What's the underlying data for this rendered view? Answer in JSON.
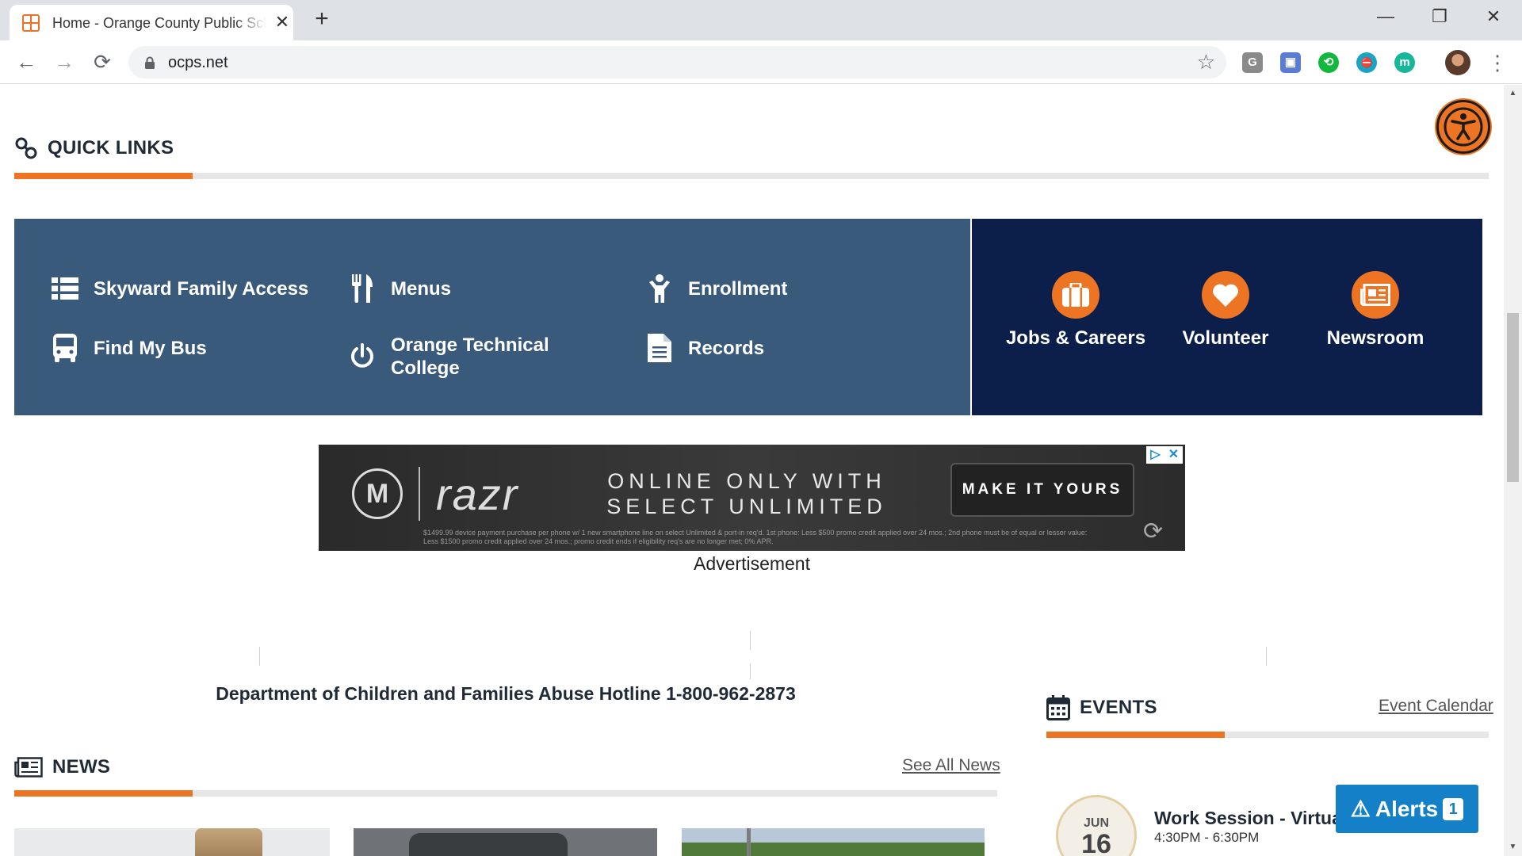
{
  "browser": {
    "tab_title": "Home - Orange County Public Schools",
    "url": "ocps.net",
    "controls": {
      "back": "←",
      "forward": "→",
      "reload": "⟳",
      "new_tab": "+",
      "close_tab": "✕",
      "minimize": "—",
      "maximize": "❐",
      "close": "✕",
      "menu": "⋮",
      "star": "☆"
    },
    "extensions": [
      {
        "name": "grammarly-extension",
        "label": "G",
        "color": "#8a8a8a"
      },
      {
        "name": "camera-extension",
        "label": "▣",
        "color": "#5b7cd6"
      },
      {
        "name": "sync-extension",
        "label": "⟲",
        "color": "#12b83e"
      },
      {
        "name": "blocked-extension",
        "label": "⛔",
        "color": "#1ba3c4"
      },
      {
        "name": "m-extension",
        "label": "m",
        "color": "#17b79a"
      }
    ]
  },
  "colors": {
    "accent": "#ec7423",
    "panel": "#3a5a7c",
    "feature_panel": "#0b1f4a",
    "alerts": "#1480c8"
  },
  "quick_links": {
    "title": "QUICK LINKS",
    "items": [
      {
        "label": "Skyward Family Access",
        "icon": "list-icon"
      },
      {
        "label": "Menus",
        "icon": "utensils-icon"
      },
      {
        "label": "Enrollment",
        "icon": "child-icon"
      },
      {
        "label": "Find My Bus",
        "icon": "bus-icon"
      },
      {
        "label": "Orange Technical College",
        "icon": "power-icon"
      },
      {
        "label": "Records",
        "icon": "document-icon"
      }
    ],
    "features": [
      {
        "label": "Jobs & Careers",
        "icon": "briefcase-icon"
      },
      {
        "label": "Volunteer",
        "icon": "heart-icon"
      },
      {
        "label": "Newsroom",
        "icon": "newspaper-icon"
      }
    ]
  },
  "ad": {
    "brand": "razr",
    "logo": "M",
    "offer": "ONLINE ONLY WITH SELECT UNLIMITED",
    "cta": "MAKE IT YOURS",
    "fine_print": "$1499.99 device payment purchase per phone w/ 1 new smartphone line on select Unlimited & port-in req'd. 1st phone: Less $500 promo credit applied over 24 mos.; 2nd phone must be of equal or lesser value: Less $1500 promo credit applied over 24 mos.; promo credit ends if eligibility req's are no longer met; 0% APR.",
    "label": "Advertisement"
  },
  "hotline": "Department of Children and Families Abuse Hotline 1-800-962-2873",
  "news": {
    "title": "NEWS",
    "link": "See All News"
  },
  "events": {
    "title": "EVENTS",
    "link": "Event Calendar",
    "items": [
      {
        "month": "JUN",
        "day": "16",
        "title": "Work Session - Virtual",
        "time": "4:30PM - 6:30PM"
      }
    ]
  },
  "alerts": {
    "label": "Alerts",
    "count": "1",
    "icon": "⚠"
  }
}
